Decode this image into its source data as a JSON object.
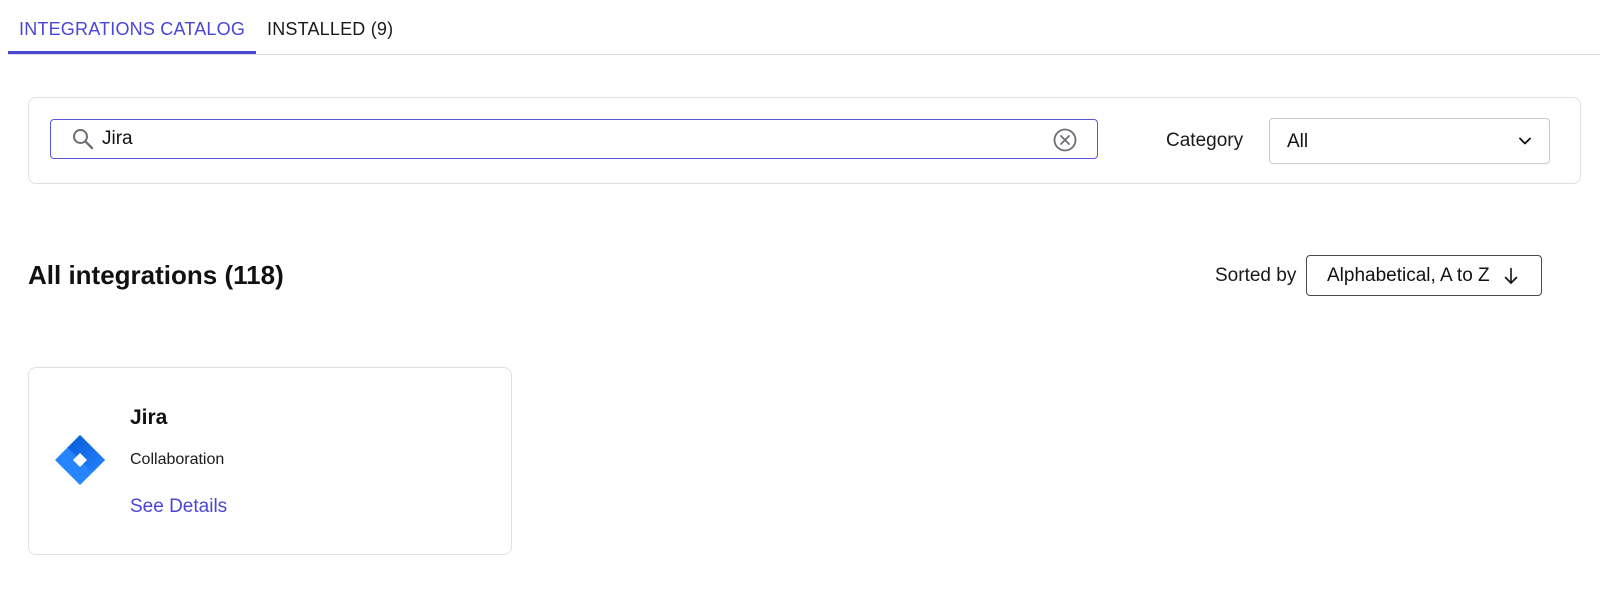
{
  "tabs": [
    {
      "label": "INTEGRATIONS CATALOG",
      "active": true
    },
    {
      "label": "INSTALLED (9)",
      "active": false
    }
  ],
  "filters": {
    "search_value": "Jira",
    "search_icon": "search-icon",
    "clear_icon": "clear-circle-icon",
    "category_label": "Category",
    "category_value": "All"
  },
  "listing": {
    "title": "All integrations (118)",
    "sorted_by_label": "Sorted by",
    "sort_value": "Alphabetical, A to Z"
  },
  "results": [
    {
      "name": "Jira",
      "category": "Collaboration",
      "link_label": "See Details",
      "logo": "jira-logo-icon"
    }
  ],
  "colors": {
    "accent": "#4b45d6",
    "jira_blue": "#2684ff",
    "border": "#dfe1e4"
  }
}
